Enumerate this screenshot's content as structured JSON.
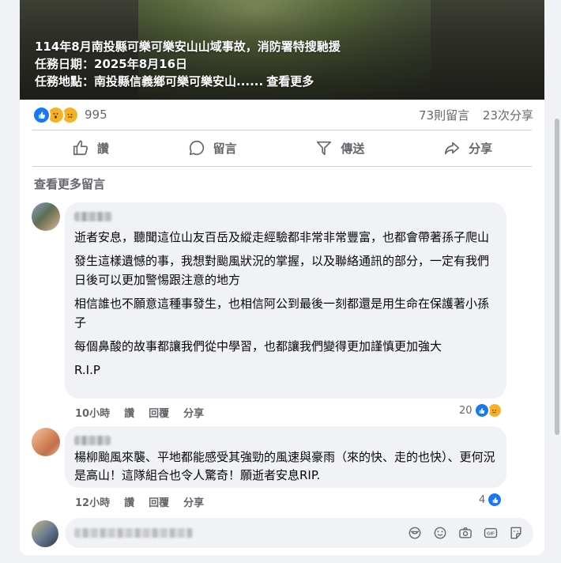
{
  "post": {
    "headline": "114年8月南投縣可樂可樂安山山域事故，消防署特搜馳援",
    "date_line": "任務日期：2025年8月16日",
    "location_line": "任務地點：南投縣信義鄉可樂可樂安山......",
    "see_more": "查看更多"
  },
  "reactions": {
    "icons": [
      "like-icon",
      "wow-icon",
      "sad-icon"
    ],
    "count": "995",
    "comments": "73則留言",
    "shares": "23次分享"
  },
  "actions": {
    "like": "讚",
    "comment": "留言",
    "send": "傳送",
    "share": "分享"
  },
  "view_more_comments": "查看更多留言",
  "comments": [
    {
      "paragraphs": [
        "逝者安息，聽聞這位山友百岳及縱走經驗都非常非常豐富，也都會帶著孫子爬山",
        "發生這樣遺憾的事，我想對颱風狀況的掌握，以及聯絡通訊的部分，一定有我們日後可以更加警惕跟注意的地方",
        "相信誰也不願意這種事發生，也相信阿公到最後一刻都還是用生命在保護著小孫子",
        "每個鼻酸的故事都讓我們從中學習，也都讓我們變得更加謹慎更加強大",
        "R.I.P"
      ],
      "time": "10小時",
      "like": "讚",
      "reply": "回覆",
      "share": "分享",
      "reaction_count": "20"
    },
    {
      "paragraphs": [
        "楊柳颱風來襲、平地都能感受其強勁的風速與豪雨（來的快、走的也快）、更何況是高山！這隊組合也令人驚奇！願逝者安息RIP."
      ],
      "time": "12小時",
      "like": "讚",
      "reply": "回覆",
      "share": "分享",
      "reaction_count": "4"
    }
  ],
  "composer_icons": [
    "avatar-sticker-icon",
    "emoji-icon",
    "camera-icon",
    "gif-icon",
    "sticker-icon"
  ],
  "colors": {
    "accent": "#1877f2",
    "muted": "#65676b",
    "bubble": "#f0f2f5",
    "reaction_yellow": "#f7b125"
  }
}
